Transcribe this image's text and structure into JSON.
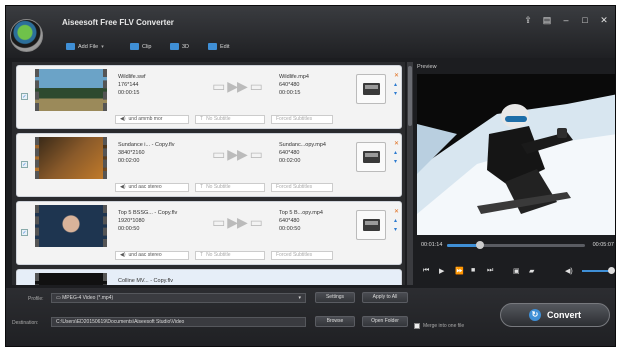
{
  "app": {
    "title": "Aiseesoft Free FLV Converter"
  },
  "toolbar": {
    "add_file": "Add File",
    "clip": "Clip",
    "three_d": "3D",
    "edit": "Edit"
  },
  "window_buttons": {
    "share": "⇪",
    "menu": "▤",
    "minimize": "–",
    "maximize": "□",
    "close": "✕"
  },
  "files": [
    {
      "name": "Wildlife.swf",
      "res": "176*144",
      "dur": "00:00:15",
      "out_name": "Wildlife.mp4",
      "out_res": "640*480",
      "out_dur": "00:00:15",
      "audio": "und amrnb mor",
      "subtitle": "No Subtitle",
      "forced": "Forced Subtitles"
    },
    {
      "name": "Sundance i... - Copy.flv",
      "res": "3840*2160",
      "dur": "00:02:00",
      "out_name": "Sundanc...opy.mp4",
      "out_res": "640*480",
      "out_dur": "00:02:00",
      "audio": "und aac stereo",
      "subtitle": "No Subtitle",
      "forced": "Forced Subtitles"
    },
    {
      "name": "Top 5 BSSG... - Copy.flv",
      "res": "1920*1080",
      "dur": "00:00:50",
      "out_name": "Top 5 B...opy.mp4",
      "out_res": "640*480",
      "out_dur": "00:00:50",
      "audio": "und aac stereo",
      "subtitle": "No Subtitle",
      "forced": "Forced Subtitles"
    },
    {
      "name": "Colline MV... - Copy.flv",
      "res": "",
      "dur": "",
      "out_name": "",
      "out_res": "",
      "out_dur": "",
      "audio": "",
      "subtitle": "",
      "forced": ""
    }
  ],
  "preview": {
    "title": "Preview",
    "time_current": "00:01:14",
    "time_total": "00:05:07",
    "progress": 0.24,
    "volume": 0.9
  },
  "bottom": {
    "profile_label": "Profile:",
    "profile_value": "MPEG-4 Video (*.mp4)",
    "settings": "Settings",
    "apply_all": "Apply to All",
    "destination_label": "Destination:",
    "destination_value": "C:\\Users\\ED20150619\\Documents\\Aiseesoft Studio\\Video",
    "browse": "Browse",
    "open_folder": "Open Folder",
    "merge": "Merge into one file",
    "convert": "Convert"
  }
}
